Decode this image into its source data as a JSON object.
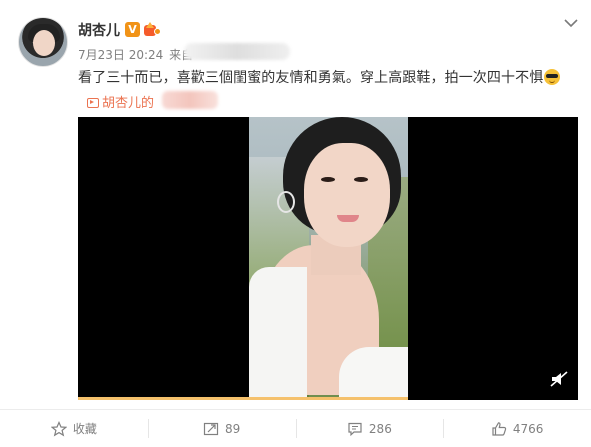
{
  "post": {
    "author": "胡杏儿",
    "verified_badge": "V",
    "timestamp": "7月23日 20:24",
    "from_label": "来自",
    "text": "看了三十而已，喜歡三個閨蜜的友情和勇氣。穿上高跟鞋，拍一次四十不惧",
    "video_link_prefix": "胡杏儿的"
  },
  "video": {
    "progress_fraction": 0.66
  },
  "actions": {
    "favorite_label": "收藏",
    "repost_count": "89",
    "comment_count": "286",
    "like_count": "4766"
  },
  "icons": [
    "chevron-down-icon",
    "video-icon",
    "mute-icon",
    "favorite-star-icon",
    "repost-icon",
    "comment-icon",
    "like-icon"
  ],
  "colors": {
    "accent_orange": "#eb7350",
    "badge_orange": "#f19317",
    "text_gray": "#808080"
  }
}
